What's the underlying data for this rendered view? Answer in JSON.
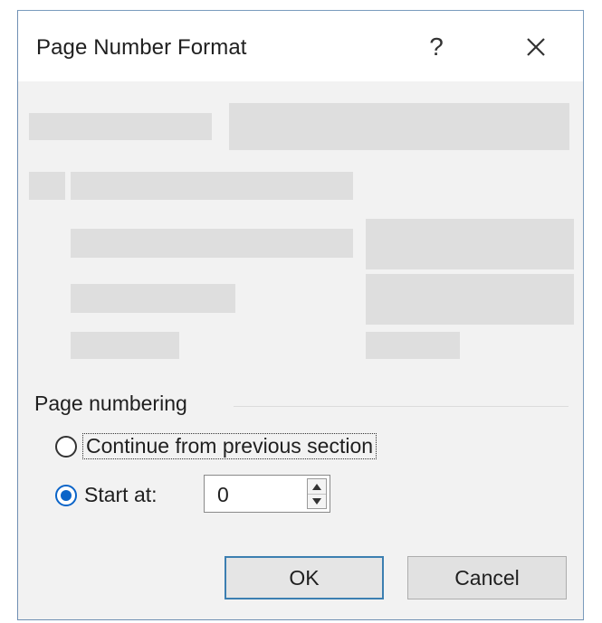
{
  "dialog": {
    "title": "Page Number Format",
    "help_glyph": "?",
    "close_icon": "close-icon"
  },
  "page_numbering": {
    "group_label": "Page numbering",
    "continue_label": "Continue from previous section",
    "start_at_label": "Start at:",
    "start_at_value": "0",
    "selected": "start_at"
  },
  "buttons": {
    "ok_label": "OK",
    "cancel_label": "Cancel"
  },
  "colors": {
    "accent": "#0a64c8",
    "ok_border": "#3c7fb1",
    "dialog_border": "#7a9bbd",
    "body_bg": "#f2f2f2",
    "placeholder": "#dedede"
  }
}
